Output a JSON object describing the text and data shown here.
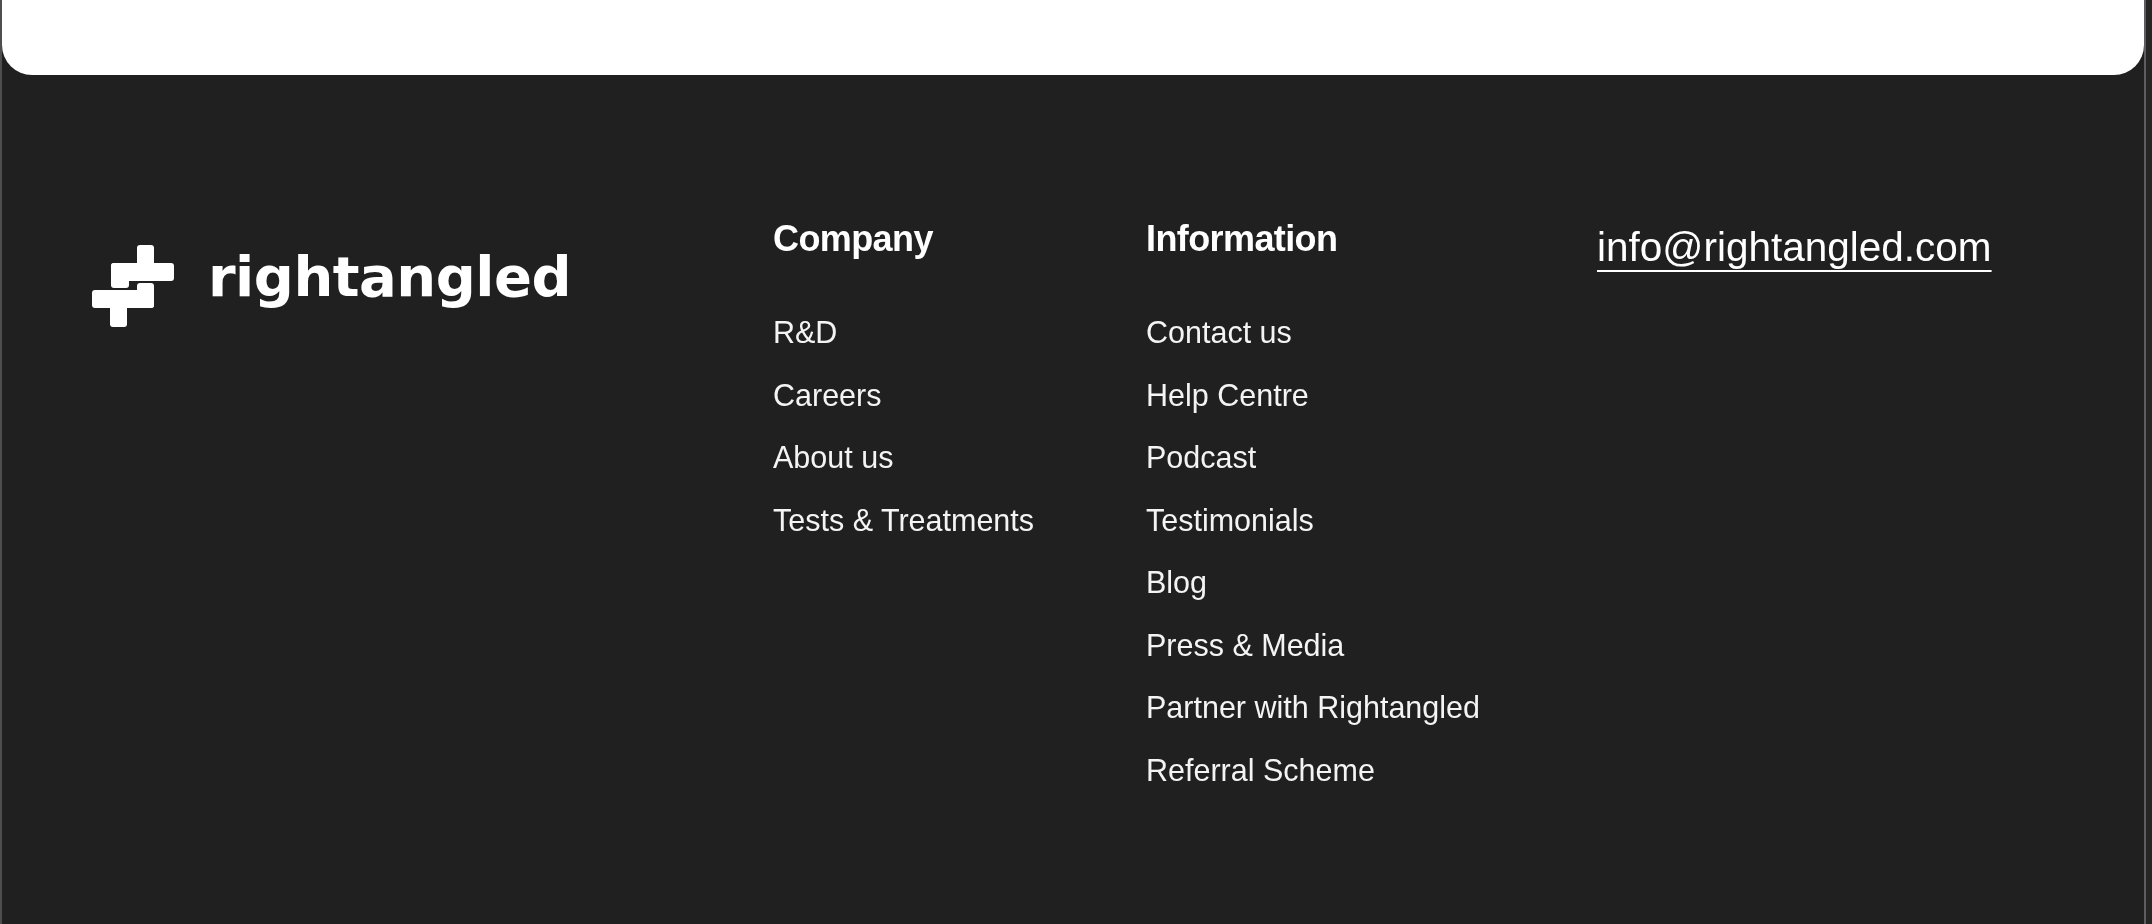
{
  "logo": {
    "wordmark": "rightangled"
  },
  "columns": [
    {
      "heading": "Company",
      "links": [
        "R&D",
        "Careers",
        "About us",
        "Tests & Treatments"
      ]
    },
    {
      "heading": "Information",
      "links": [
        "Contact us",
        "Help Centre",
        "Podcast",
        "Testimonials",
        "Blog",
        "Press & Media",
        "Partner with Rightangled",
        "Referral Scheme"
      ]
    }
  ],
  "contact": {
    "email": "info@rightangled.com"
  }
}
